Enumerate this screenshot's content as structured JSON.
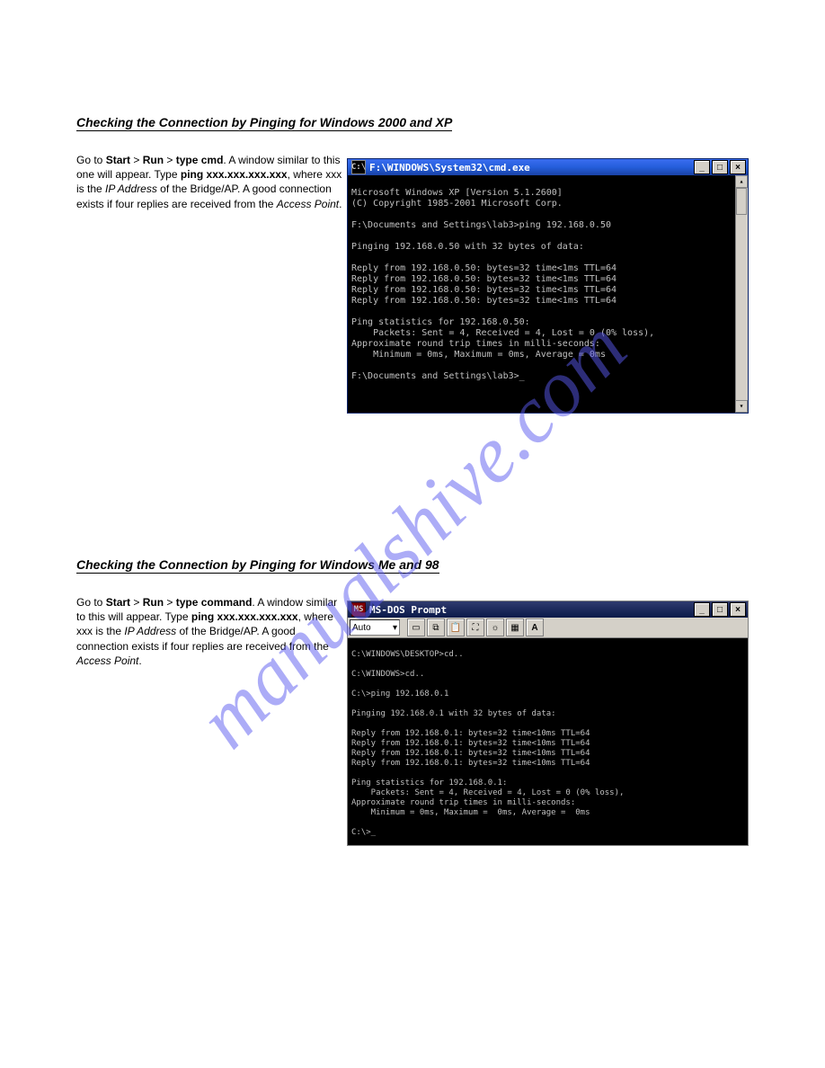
{
  "watermark": "manualshive.com",
  "section1": {
    "title": "Checking the Connection by Pinging for Windows 2000 and XP",
    "p1": {
      "b1": "Start",
      "b2": "Run",
      "b3": "type cmd",
      "b4": "ping xxx.xxx.xxx.xxx",
      "xxx": "xxx",
      "i1": "IP Address",
      "i2": "Access Point"
    }
  },
  "section2": {
    "title": "Checking the Connection by Pinging for Windows Me and 98",
    "p1": {
      "b1": "Start",
      "b2": "Run",
      "b3": "type command",
      "b4": "ping xxx.xxx.xxx.xxx",
      "xxx": "xxx",
      "i1": "IP Address",
      "i2": "Access Point"
    }
  },
  "cmd": {
    "title": "F:\\WINDOWS\\System32\\cmd.exe",
    "lines": [
      "Microsoft Windows XP [Version 5.1.2600]",
      "(C) Copyright 1985-2001 Microsoft Corp.",
      "F:\\Documents and Settings\\lab3>ping 192.168.0.50",
      "Pinging 192.168.0.50 with 32 bytes of data:",
      "Reply from 192.168.0.50: bytes=32 time<1ms TTL=64",
      "Reply from 192.168.0.50: bytes=32 time<1ms TTL=64",
      "Reply from 192.168.0.50: bytes=32 time<1ms TTL=64",
      "Reply from 192.168.0.50: bytes=32 time<1ms TTL=64",
      "Ping statistics for 192.168.0.50:",
      "    Packets: Sent = 4, Received = 4, Lost = 0 (0% loss),",
      "Approximate round trip times in milli-seconds:",
      "    Minimum = 0ms, Maximum = 0ms, Average = 0ms",
      "F:\\Documents and Settings\\lab3>_"
    ]
  },
  "dos": {
    "title": "MS-DOS Prompt",
    "toolbar": {
      "combo": "Auto"
    },
    "lines": [
      "C:\\WINDOWS\\DESKTOP>cd..",
      "C:\\WINDOWS>cd..",
      "C:\\>ping 192.168.0.1",
      "Pinging 192.168.0.1 with 32 bytes of data:",
      "Reply from 192.168.0.1: bytes=32 time<10ms TTL=64",
      "Reply from 192.168.0.1: bytes=32 time<10ms TTL=64",
      "Reply from 192.168.0.1: bytes=32 time<10ms TTL=64",
      "Reply from 192.168.0.1: bytes=32 time<10ms TTL=64",
      "Ping statistics for 192.168.0.1:",
      "    Packets: Sent = 4, Received = 4, Lost = 0 (0% loss),",
      "Approximate round trip times in milli-seconds:",
      "    Minimum = 0ms, Maximum =  0ms, Average =  0ms",
      "C:\\>_"
    ]
  }
}
